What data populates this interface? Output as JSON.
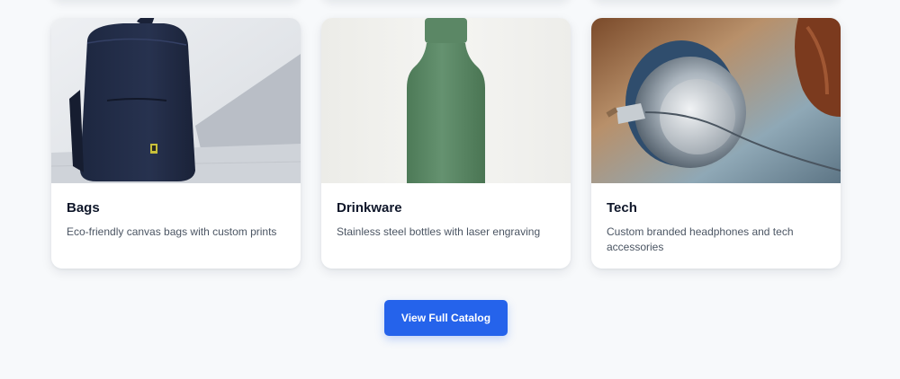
{
  "products": [
    {
      "title": "Bags",
      "description": "Eco-friendly canvas bags with custom prints",
      "image": "backpack-image"
    },
    {
      "title": "Drinkware",
      "description": "Stainless steel bottles with laser engraving",
      "image": "bottle-image"
    },
    {
      "title": "Tech",
      "description": "Custom branded headphones and tech accessories",
      "image": "headphones-image"
    }
  ],
  "cta": {
    "label": "View Full Catalog"
  },
  "colors": {
    "background": "#f7f9fb",
    "accent": "#2563eb",
    "card": "#ffffff",
    "title": "#0f172a",
    "text": "#4b5563"
  }
}
